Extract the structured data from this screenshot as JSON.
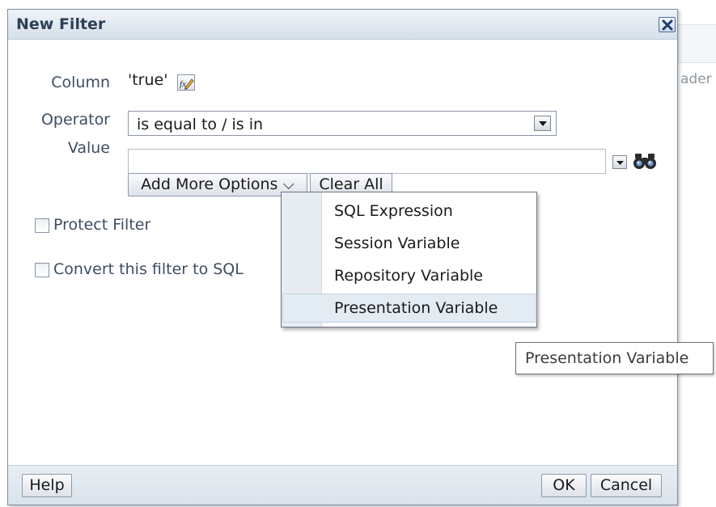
{
  "background": {
    "partial_text": "ader"
  },
  "dialog": {
    "title": "New Filter",
    "close_icon": "close-x-icon"
  },
  "form": {
    "column_label": "Column",
    "column_value": "'true'",
    "edit_formula_icon": "edit-formula-icon",
    "operator_label": "Operator",
    "operator_value": "is equal to / is in",
    "value_label": "Value",
    "value_input": "",
    "search_icon": "binoculars-icon"
  },
  "buttons": {
    "add_more_options": "Add More Options ⌵",
    "clear_all": "Clear All",
    "help": "Help",
    "ok": "OK",
    "cancel": "Cancel"
  },
  "checkboxes": {
    "protect_filter": {
      "label": "Protect Filter",
      "checked": false
    },
    "convert_sql": {
      "label": "Convert this filter to SQL",
      "checked": false
    }
  },
  "menu": {
    "items": [
      "SQL Expression",
      "Session Variable",
      "Repository Variable",
      "Presentation Variable"
    ],
    "highlighted": "Presentation Variable"
  },
  "tooltip": {
    "text": "Presentation Variable"
  },
  "colors": {
    "title_text": "#2f3f55",
    "label_text": "#3d4e63",
    "titlebar_top": "#eef3f8",
    "titlebar_bottom": "#d6e0ea",
    "menu_highlight": "#e3ebf3"
  }
}
